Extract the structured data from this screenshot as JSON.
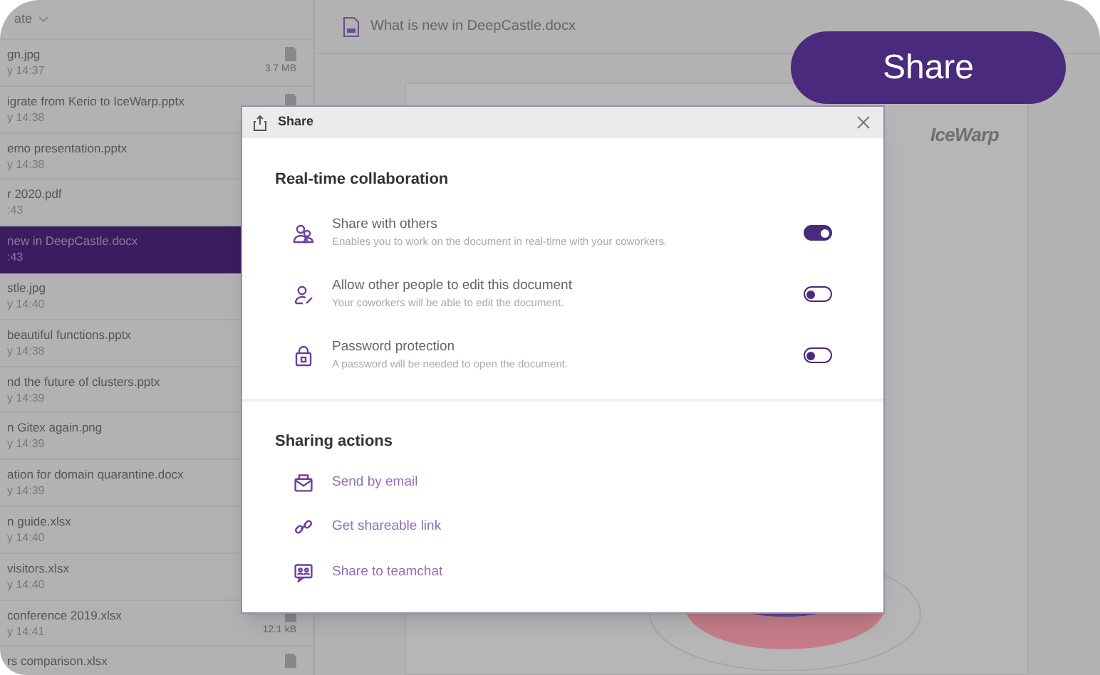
{
  "sidebar": {
    "sort_label": "ate",
    "files": [
      {
        "name": "gn.jpg",
        "time": "y 14:37",
        "size": "3.7 MB",
        "selected": false
      },
      {
        "name": "igrate from Kerio to IceWarp.pptx",
        "time": "y 14:38",
        "selected": false
      },
      {
        "name": "emo presentation.pptx",
        "time": "y 14:38",
        "selected": false
      },
      {
        "name": "r 2020.pdf",
        "time": ":43",
        "selected": false
      },
      {
        "name": "new in DeepCastle.docx",
        "time": ":43",
        "selected": true
      },
      {
        "name": "stle.jpg",
        "time": "y 14:40",
        "selected": false
      },
      {
        "name": "beautiful functions.pptx",
        "time": "y 14:38",
        "selected": false
      },
      {
        "name": "nd the future of clusters.pptx",
        "time": "y 14:39",
        "selected": false
      },
      {
        "name": "n Gitex again.png",
        "time": "y 14:39",
        "selected": false
      },
      {
        "name": "ation for domain quarantine.docx",
        "time": "y 14:39",
        "selected": false
      },
      {
        "name": "n guide.xlsx",
        "time": "y 14:40",
        "selected": false
      },
      {
        "name": "visitors.xlsx",
        "time": "y 14:40",
        "selected": false
      },
      {
        "name": "conference 2019.xlsx",
        "time": "y 14:41",
        "size": "12.1 kB",
        "selected": false
      },
      {
        "name": "rs comparison.xlsx",
        "selected": false
      }
    ]
  },
  "document": {
    "title": "What is new in DeepCastle.docx",
    "logo": "IceWarp"
  },
  "share_badge": "Share",
  "dialog": {
    "title": "Share",
    "collaboration": {
      "heading": "Real-time collaboration",
      "options": [
        {
          "kind": "people",
          "label": "Share with others",
          "description": "Enables you to work on the document in real-time with your coworkers.",
          "on": true
        },
        {
          "kind": "edit",
          "label": "Allow other people to edit this document",
          "description": "Your coworkers will be able to edit the document.",
          "on": false
        },
        {
          "kind": "lock",
          "label": "Password protection",
          "description": "A password will be needed to open the document.",
          "on": false
        }
      ]
    },
    "actions": {
      "heading": "Sharing actions",
      "items": [
        {
          "kind": "email",
          "label": "Send by email"
        },
        {
          "kind": "link",
          "label": "Get shareable link"
        },
        {
          "kind": "chat",
          "label": "Share to teamchat"
        }
      ]
    }
  }
}
